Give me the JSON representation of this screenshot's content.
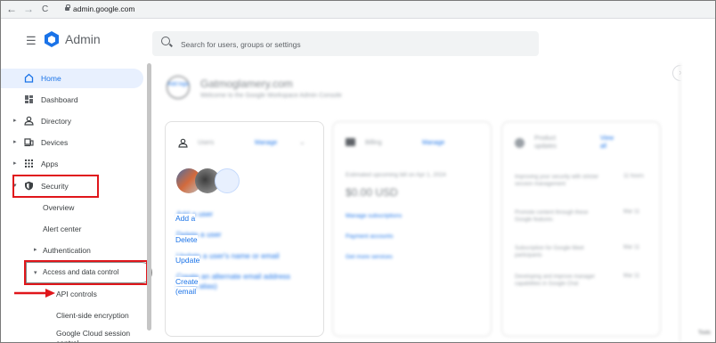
{
  "browser": {
    "back": "←",
    "forward": "→",
    "reload": "C",
    "url": "admin.google.com"
  },
  "header": {
    "app_title": "Admin",
    "search_placeholder": "Search for users, groups or settings"
  },
  "sidebar": {
    "items": [
      {
        "label": "Home"
      },
      {
        "label": "Dashboard"
      },
      {
        "label": "Directory"
      },
      {
        "label": "Devices"
      },
      {
        "label": "Apps"
      },
      {
        "label": "Security"
      }
    ],
    "security_sub": [
      "Overview",
      "Alert center",
      "Authentication",
      "Access and data control"
    ],
    "access_sub": [
      "API controls",
      "Client-side encryption",
      "Google Cloud session control"
    ]
  },
  "main": {
    "add_logo": "Add logo",
    "domain": "Gatmoglamery.com",
    "welcome": "Welcome to the Google Workspace Admin Console",
    "users_card": {
      "title": "Users",
      "manage": "Manage",
      "actions": [
        "Add a user",
        "Delete a user",
        "Update a user's name or email",
        "Create an alternate email address (email alias)"
      ]
    },
    "billing_card": {
      "title": "Billing",
      "manage": "Manage",
      "estimate": "Estimated upcoming bill on Apr 1, 2024",
      "amount": "$0.00 USD",
      "links": [
        "Manage subscriptions",
        "Payment accounts",
        "Get more services"
      ]
    },
    "product_card": {
      "title": "Product updates",
      "view_all": "View all",
      "items": [
        {
          "text": "Improving your security with stricter session management",
          "date": "11 hours"
        },
        {
          "text": "Promote content through these Google features",
          "date": "Mar 11"
        },
        {
          "text": "Subscription for Google Meet participants",
          "date": "Mar 11"
        },
        {
          "text": "Developing and improve manager capabilities in Google Chat",
          "date": "Mar 11"
        }
      ]
    },
    "right_label": "Tools"
  },
  "colors": {
    "accent": "#1a73e8",
    "highlight": "#e0161b",
    "home_bg": "#e8f0fe"
  }
}
